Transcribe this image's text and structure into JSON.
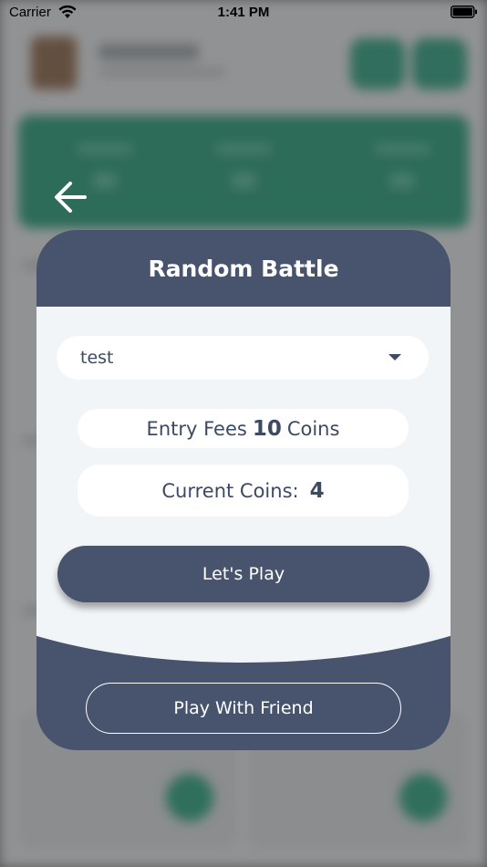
{
  "status_bar": {
    "carrier": "Carrier",
    "time": "1:41 PM",
    "icons": [
      "wifi-icon",
      "battery-icon"
    ]
  },
  "back_icon": "arrow-left-icon",
  "dialog": {
    "title": "Random Battle",
    "category": {
      "selected": "test",
      "icon": "chevron-down-icon"
    },
    "entry_fees": {
      "label": "Entry Fees",
      "amount": "10",
      "unit": "Coins"
    },
    "current_coins": {
      "label": "Current Coins:",
      "amount": "4"
    },
    "lets_play_label": "Let's Play",
    "play_with_friend_label": "Play With Friend"
  },
  "colors": {
    "dialog_primary": "#48546e",
    "dialog_surface": "#f2f5f8",
    "text_primary": "#3d4a63",
    "background_accent": "#0f9b6c"
  }
}
